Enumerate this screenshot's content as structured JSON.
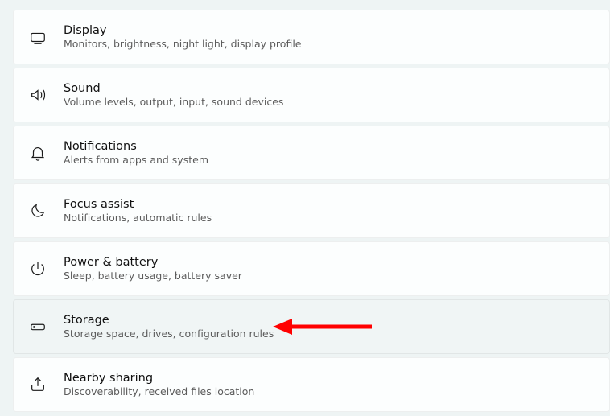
{
  "settings": {
    "items": [
      {
        "key": "display",
        "title": "Display",
        "subtitle": "Monitors, brightness, night light, display profile",
        "highlight": false
      },
      {
        "key": "sound",
        "title": "Sound",
        "subtitle": "Volume levels, output, input, sound devices",
        "highlight": false
      },
      {
        "key": "notifications",
        "title": "Notifications",
        "subtitle": "Alerts from apps and system",
        "highlight": false
      },
      {
        "key": "focus-assist",
        "title": "Focus assist",
        "subtitle": "Notifications, automatic rules",
        "highlight": false
      },
      {
        "key": "power-battery",
        "title": "Power & battery",
        "subtitle": "Sleep, battery usage, battery saver",
        "highlight": false
      },
      {
        "key": "storage",
        "title": "Storage",
        "subtitle": "Storage space, drives, configuration rules",
        "highlight": true
      },
      {
        "key": "nearby-sharing",
        "title": "Nearby sharing",
        "subtitle": "Discoverability, received files location",
        "highlight": false
      }
    ]
  },
  "annotation": {
    "arrow_target": "storage",
    "arrow_color": "#ff0000"
  }
}
